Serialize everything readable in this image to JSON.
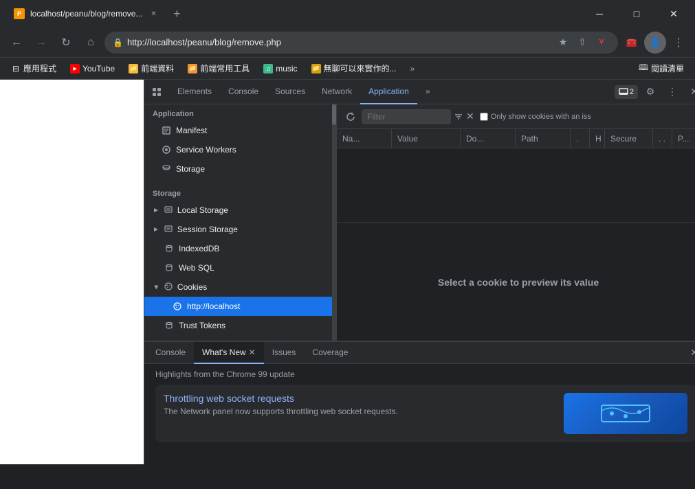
{
  "browser": {
    "tab_title": "localhost/peanu/blog/remove...",
    "url": "http://localhost/peanu/blog/remove.php",
    "window_controls": {
      "minimize": "─",
      "maximize": "□",
      "close": "✕"
    }
  },
  "bookmarks": {
    "apps_label": "應用程式",
    "youtube_label": "YouTube",
    "folder1_label": "前端資料",
    "folder2_label": "前端常用工具",
    "music_label": "music",
    "folder3_label": "無聊可以來實作的...",
    "more_label": "»",
    "reading_list_label": "閱讀清單"
  },
  "devtools": {
    "tabs": [
      {
        "label": "Elements",
        "active": false
      },
      {
        "label": "Console",
        "active": false
      },
      {
        "label": "Sources",
        "active": false
      },
      {
        "label": "Network",
        "active": false
      },
      {
        "label": "Application",
        "active": true
      },
      {
        "label": "»",
        "active": false
      }
    ],
    "dock_count": "2",
    "sidebar": {
      "application_section": "Application",
      "manifest_label": "Manifest",
      "service_workers_label": "Service Workers",
      "storage_label": "Storage",
      "storage_section": "Storage",
      "local_storage_label": "Local Storage",
      "session_storage_label": "Session Storage",
      "indexeddb_label": "IndexedDB",
      "web_sql_label": "Web SQL",
      "cookies_label": "Cookies",
      "localhost_label": "http://localhost",
      "trust_tokens_label": "Trust Tokens"
    },
    "cookie_panel": {
      "filter_placeholder": "Filter",
      "only_issues_label": "Only show cookies with an iss",
      "columns": [
        "Na...",
        "Value",
        "Do...",
        "Path",
        ".",
        "H",
        "Secure",
        ". .",
        "P..."
      ],
      "preview_text": "Select a cookie to preview its value"
    }
  },
  "bottom_panel": {
    "tabs": [
      {
        "label": "Console",
        "active": false
      },
      {
        "label": "What's New",
        "active": true,
        "closeable": true
      },
      {
        "label": "Issues",
        "active": false
      },
      {
        "label": "Coverage",
        "active": false
      }
    ],
    "highlights_header": "Highlights from the Chrome 99 update",
    "news_card": {
      "title": "Throttling web socket requests",
      "description": "The Network panel now supports throttling web socket requests."
    }
  }
}
